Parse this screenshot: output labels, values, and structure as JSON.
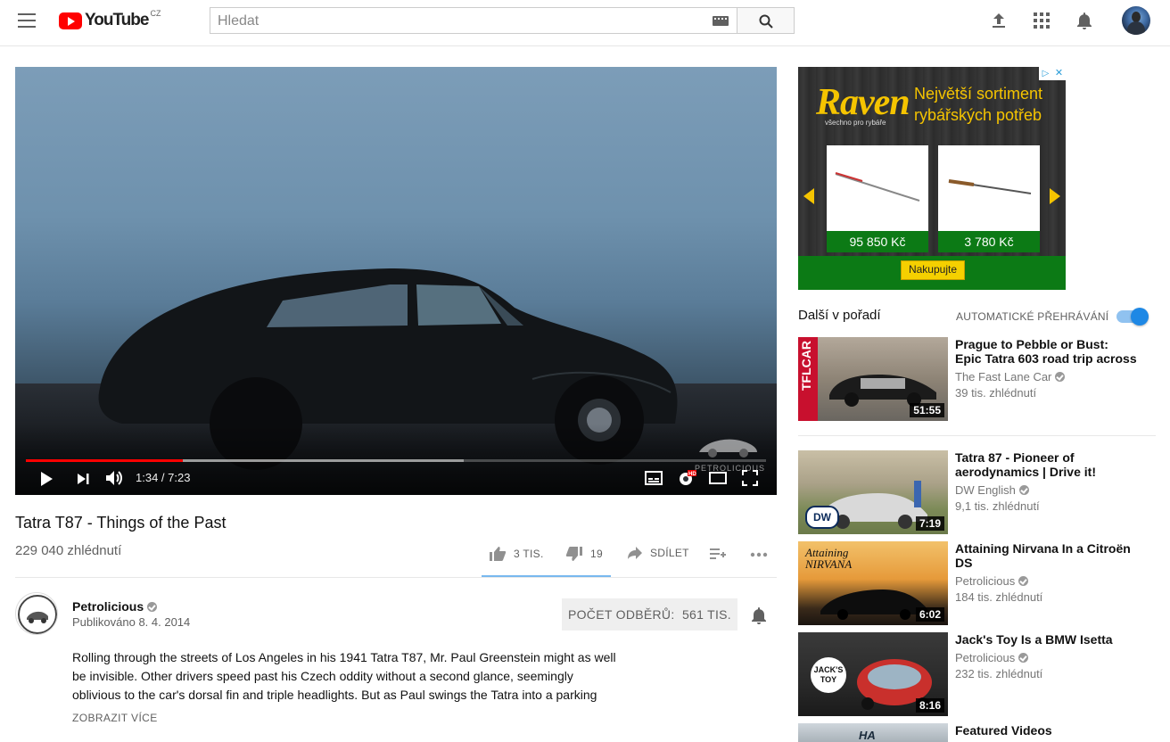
{
  "header": {
    "logo_text": "YouTube",
    "logo_country": "CZ",
    "search_placeholder": "Hledat"
  },
  "player": {
    "time": "1:34 / 7:23",
    "progress_played": 0.212,
    "progress_buffered": 0.592,
    "watermark": "PETROLICIOUS"
  },
  "video": {
    "title": "Tatra T87 - Things of the Past",
    "views": "229 040 zhlédnutí",
    "likes": "3 TIS.",
    "dislikes": "19",
    "share_label": "SDÍLET"
  },
  "channel": {
    "name": "Petrolicious",
    "published": "Publikováno 8. 4. 2014",
    "subscribe_label": "POČET ODBĚRŮ:",
    "subscriber_count": "561 TIS.",
    "description": "Rolling through the streets of Los Angeles in his 1941 Tatra T87, Mr. Paul Greenstein might as well be invisible. Other drivers speed past his Czech oddity without a second glance, seemingly oblivious to the car's dorsal fin and triple headlights. But as Paul swings the Tatra into a parking",
    "show_more": "ZOBRAZIT VÍCE"
  },
  "ad": {
    "brand": "Raven",
    "tagline": "všechno pro rybáře",
    "headline": "Největší sortiment rybářských potřeb",
    "products": [
      {
        "price": "95 850 Kč"
      },
      {
        "price": "3 780 Kč"
      }
    ],
    "cta": "Nakupujte"
  },
  "sidebar": {
    "up_next": "Další v pořadí",
    "autoplay_label": "AUTOMATICKÉ PŘEHRÁVÁNÍ",
    "autoplay_on": true,
    "items": [
      {
        "title": "Prague to Pebble or Bust: Epic Tatra 603 road trip across",
        "channel": "The Fast Lane Car",
        "views": "39 tis. zhlédnutí",
        "duration": "51:55",
        "badge": "TFLCAR"
      },
      {
        "title": "Tatra 87 - Pioneer of aerodynamics | Drive it!",
        "channel": "DW English",
        "views": "9,1 tis. zhlédnutí",
        "duration": "7:19",
        "badge": "DW"
      },
      {
        "title": "Attaining Nirvana In a Citroën DS",
        "channel": "Petrolicious",
        "views": "184 tis. zhlédnutí",
        "duration": "6:02",
        "badge": "Attaining NIRVANA"
      },
      {
        "title": "Jack's Toy Is a BMW Isetta",
        "channel": "Petrolicious",
        "views": "232 tis. zhlédnutí",
        "duration": "8:16",
        "badge": "JACK'S TOY"
      },
      {
        "title": "Featured Videos",
        "channel": "",
        "views": "",
        "duration": "",
        "badge": "HA"
      }
    ]
  },
  "colors": {
    "brand_red": "#ff0000",
    "accent_blue": "#1e88e5"
  }
}
